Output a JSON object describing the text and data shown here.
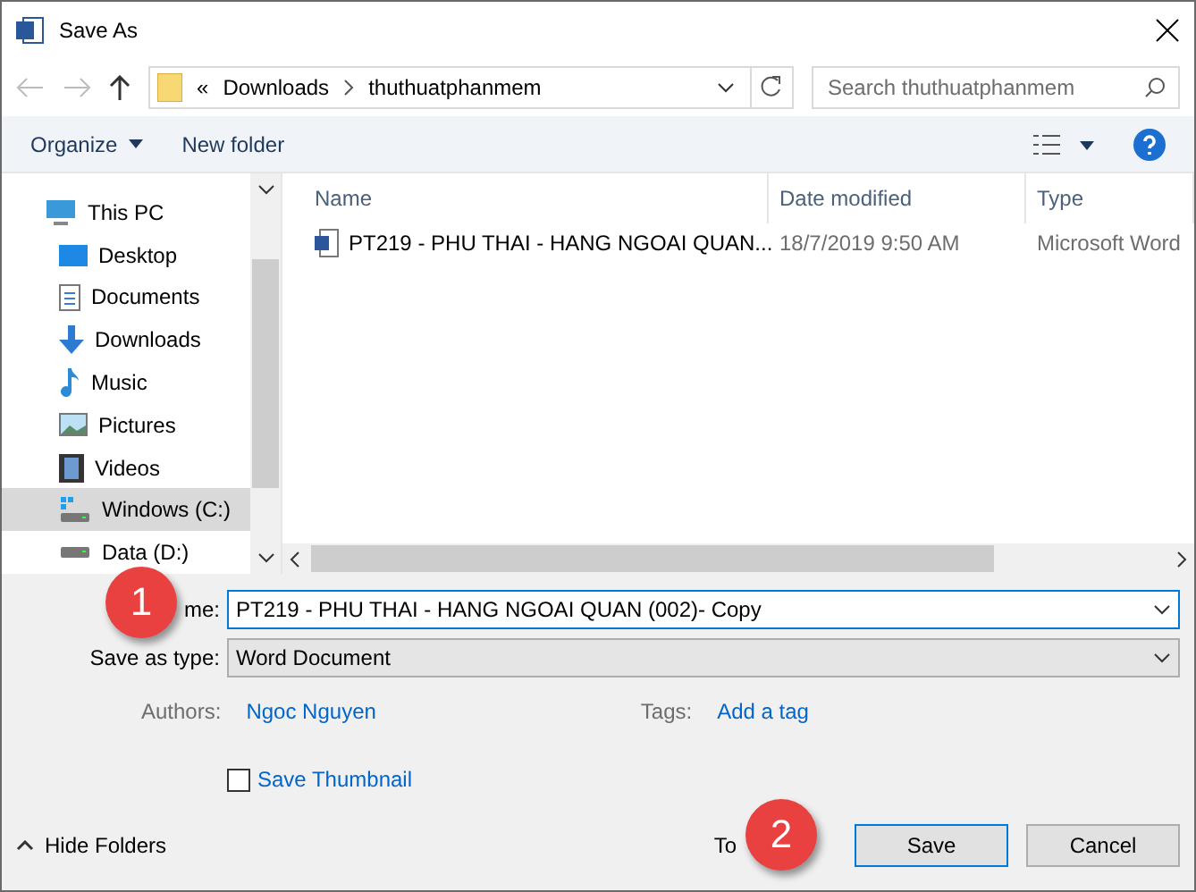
{
  "window": {
    "title": "Save As"
  },
  "address": {
    "overflow": "«",
    "crumbs": [
      "Downloads",
      "thuthuatphanmem"
    ]
  },
  "search": {
    "placeholder": "Search thuthuatphanmem"
  },
  "toolbar": {
    "organize": "Organize",
    "new_folder": "New folder"
  },
  "sidebar": {
    "items": [
      {
        "label": "This PC",
        "selected": false,
        "children": [
          {
            "label": "Desktop",
            "selected": false
          },
          {
            "label": "Documents",
            "selected": false
          },
          {
            "label": "Downloads",
            "selected": false
          },
          {
            "label": "Music",
            "selected": false
          },
          {
            "label": "Pictures",
            "selected": false
          },
          {
            "label": "Videos",
            "selected": false
          },
          {
            "label": "Windows (C:)",
            "selected": true
          },
          {
            "label": "Data (D:)",
            "selected": false
          }
        ]
      }
    ]
  },
  "table": {
    "columns": [
      "Name",
      "Date modified",
      "Type"
    ],
    "rows": [
      {
        "name": "PT219 - PHU THAI - HANG NGOAI QUAN...",
        "date": "18/7/2019 9:50 AM",
        "type": "Microsoft Word"
      }
    ]
  },
  "form": {
    "file_name_label": "me:",
    "file_name": "PT219 - PHU THAI - HANG NGOAI QUAN (002)- Copy",
    "type_label": "Save as type:",
    "type_value": "Word Document",
    "authors_label": "Authors:",
    "authors": "Ngoc Nguyen",
    "tags_label": "Tags:",
    "tags": "Add a tag",
    "thumbnail": {
      "label": "Save Thumbnail",
      "checked": false
    }
  },
  "footer": {
    "hide_folders": "Hide Folders",
    "tools": "To",
    "save": "Save",
    "cancel": "Cancel"
  },
  "callouts": [
    {
      "number": "1"
    },
    {
      "number": "2"
    }
  ]
}
